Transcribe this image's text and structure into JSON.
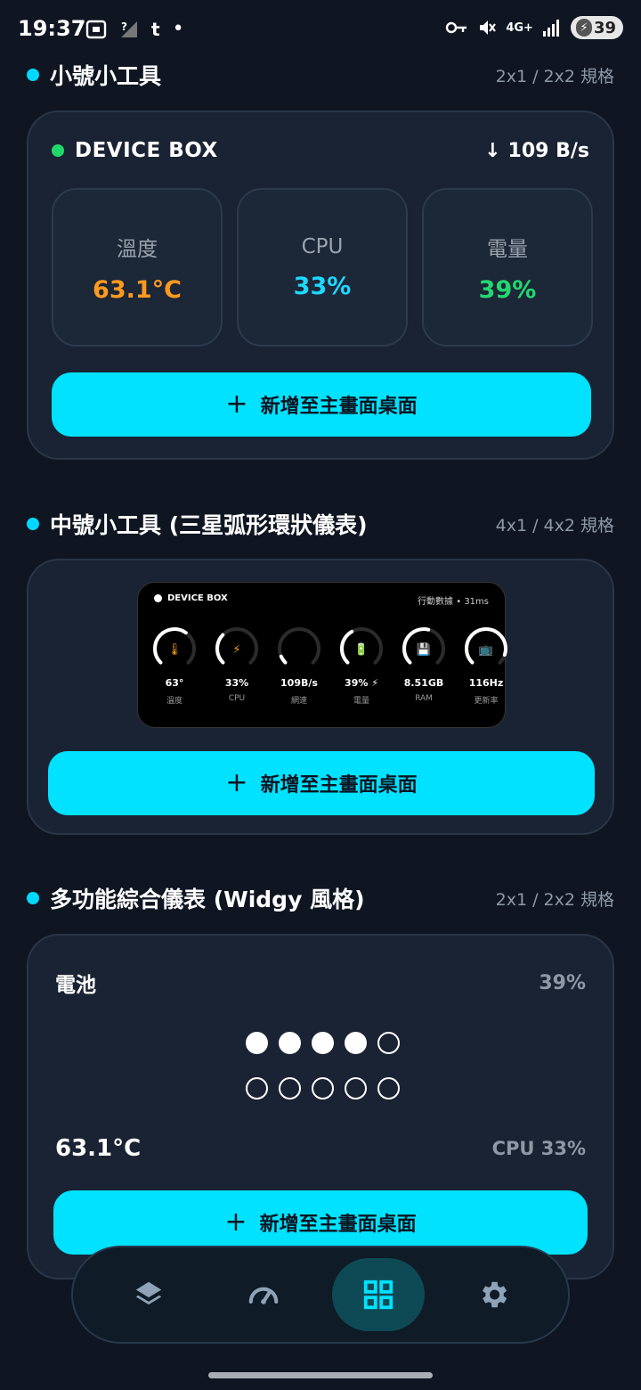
{
  "status_bar": {
    "time": "19:37",
    "battery": "39",
    "network": "4G+"
  },
  "sections": {
    "small": {
      "title": "小號小工具",
      "size": "2x1 / 2x2 規格"
    },
    "medium": {
      "title": "中號小工具 (三星弧形環狀儀表)",
      "size": "4x1 / 4x2 規格"
    },
    "widgy": {
      "title": "多功能綜合儀表 (Widgy 風格)",
      "size": "2x1 / 2x2 規格"
    }
  },
  "small_widget": {
    "device_name": "DEVICE BOX",
    "speed": "109 B/s",
    "tiles": [
      {
        "label": "溫度",
        "value": "63.1°C",
        "color": "#ff9a1f"
      },
      {
        "label": "CPU",
        "value": "33%",
        "color": "#1ed8ff"
      },
      {
        "label": "電量",
        "value": "39%",
        "color": "#22d86e"
      }
    ]
  },
  "add_button_label": "新增至主畫面桌面",
  "medium_widget": {
    "device_name": "DEVICE BOX",
    "status": "行動數據 • 31ms",
    "gauges": [
      {
        "value": "63°",
        "label": "溫度",
        "icon": "thermometer-icon",
        "level": 0.63
      },
      {
        "value": "33%",
        "label": "CPU",
        "icon": "lightning-icon",
        "level": 0.33
      },
      {
        "value": "109B/s",
        "label": "網速",
        "icon": "speed-icon",
        "level": 0.08
      },
      {
        "value": "39% ⚡",
        "label": "電量",
        "icon": "battery-icon",
        "level": 0.39
      },
      {
        "value": "8.51GB",
        "label": "RAM",
        "icon": "floppy-icon",
        "level": 0.55
      },
      {
        "value": "116Hz",
        "label": "更新率",
        "icon": "monitor-icon",
        "level": 0.9
      }
    ]
  },
  "widgy_widget": {
    "battery_label": "電池",
    "battery_pct": "39%",
    "dots_filled": 4,
    "dots_total": 10,
    "temperature": "63.1°C",
    "cpu": "CPU 33%"
  },
  "bottom_nav": [
    {
      "name": "layers-icon",
      "active": false
    },
    {
      "name": "speedometer-icon",
      "active": false
    },
    {
      "name": "widgets-grid-icon",
      "active": true
    },
    {
      "name": "settings-gear-icon",
      "active": false
    }
  ]
}
